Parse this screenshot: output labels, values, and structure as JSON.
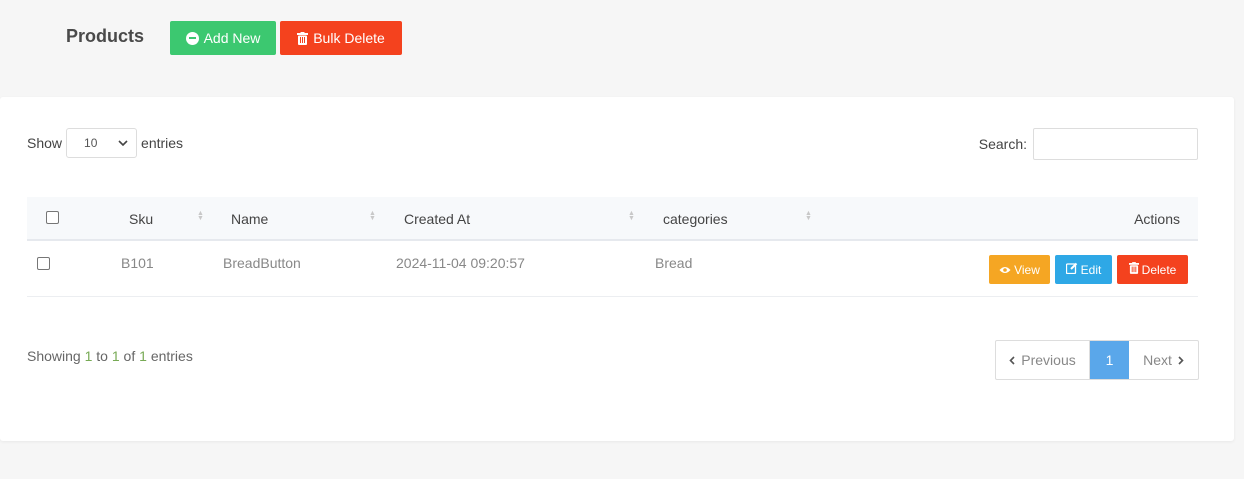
{
  "header": {
    "title": "Products",
    "add_label": "Add New",
    "bulk_delete_label": "Bulk Delete"
  },
  "controls": {
    "show_label": "Show",
    "entries_label": "entries",
    "page_size": "10",
    "search_label": "Search:",
    "search_value": ""
  },
  "table": {
    "columns": [
      "Sku",
      "Name",
      "Created At",
      "categories",
      "Actions"
    ],
    "rows": [
      {
        "sku": "B101",
        "name": "BreadButton",
        "created_at": "2024-11-04 09:20:57",
        "category": "Bread",
        "actions": [
          "View",
          "Edit",
          "Delete"
        ]
      }
    ]
  },
  "footer": {
    "info_prefix": "Showing",
    "info_from": "1",
    "info_to_word": "to",
    "info_to": "1",
    "info_of_word": "of",
    "info_total": "1",
    "info_suffix": "entries",
    "prev_label": "Previous",
    "current_page": "1",
    "next_label": "Next"
  },
  "colors": {
    "add": "#3cc870",
    "delete": "#f4421e",
    "view": "#f5a623",
    "edit": "#2ea8e6",
    "active_page": "#5aa7ea"
  }
}
